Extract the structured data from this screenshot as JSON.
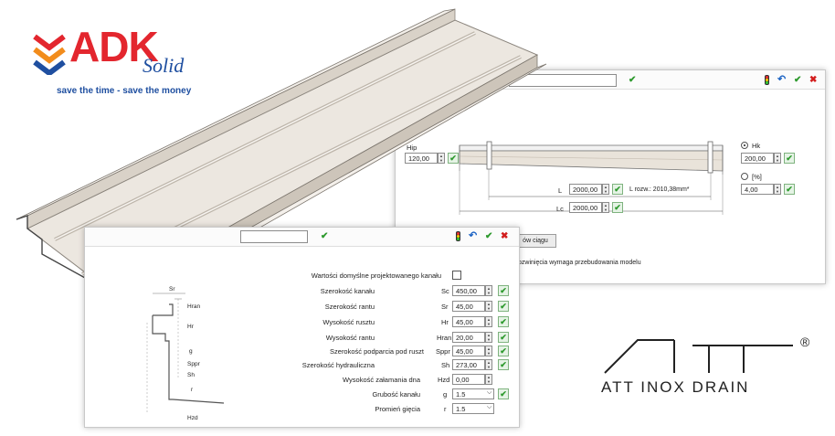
{
  "brand": {
    "logo_main": "ADK",
    "logo_sub": "Solid",
    "tagline": "save the time - save the money",
    "partner_logo": "ATT INOX DRAIN",
    "registered_mark": "®",
    "colors": {
      "adk_red": "#e3262e",
      "adk_blue": "#1f4fa0",
      "steel": "#ece7e0"
    }
  },
  "back_panel": {
    "hip_label": "Hip",
    "hip_value": "120,00",
    "hk_label": "Hk",
    "hk_value": "200,00",
    "pct_label": "[%]",
    "pct_value": "4,00",
    "l_label": "L",
    "l_value": "2000,00",
    "l_rozw": "L rozw.: 2010,38mm*",
    "lc_label": "Lc",
    "lc_value": "2000,00",
    "button_label": "ów ciągu",
    "note": "ozwinięcia wymaga przebudowania modelu"
  },
  "front_panel": {
    "default_values_label": "Wartości domyślne projektowanego kanału",
    "params": [
      {
        "label": "Szerokość kanału",
        "symbol": "Sc",
        "value": "450,00",
        "kind": "spin"
      },
      {
        "label": "Szerokość rantu",
        "symbol": "Sr",
        "value": "45,00",
        "kind": "spin"
      },
      {
        "label": "Wysokość rusztu",
        "symbol": "Hr",
        "value": "45,00",
        "kind": "spin"
      },
      {
        "label": "Wysokość rantu",
        "symbol": "Hran",
        "value": "20,00",
        "kind": "spin"
      },
      {
        "label": "Szerokość podparcia pod ruszt",
        "symbol": "Sppr",
        "value": "45,00",
        "kind": "spin"
      },
      {
        "label": "Szerokość hydrauliczna",
        "symbol": "Sh",
        "value": "273,00",
        "kind": "spin"
      },
      {
        "label": "Wysokość załamania dna",
        "symbol": "Hzd",
        "value": "0,00",
        "kind": "spin"
      },
      {
        "label": "Grubość kanału",
        "symbol": "g",
        "value": "1.5",
        "kind": "select"
      },
      {
        "label": "Promień gięcia",
        "symbol": "r",
        "value": "1.5",
        "kind": "select"
      }
    ],
    "diagram_labels": {
      "sr": "Sr",
      "hran": "Hran",
      "hr": "Hr",
      "g": "g",
      "sppr": "Sppr",
      "sh": "Sh",
      "r": "r",
      "hzd": "Hzd"
    }
  },
  "icons": [
    "check-icon",
    "undo-icon",
    "close-icon",
    "traffic-light-icon",
    "spin-arrows-icon",
    "dropdown-icon"
  ]
}
